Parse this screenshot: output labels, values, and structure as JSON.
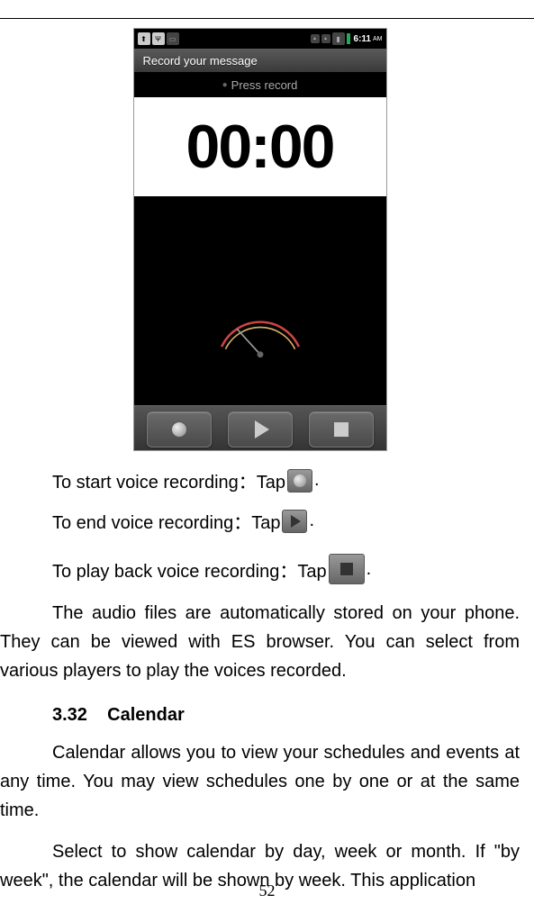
{
  "screenshot": {
    "status_time": "6:11",
    "status_ampm": "AM",
    "title_bar": "Record your message",
    "hint": "Press record",
    "timer": "00:00"
  },
  "instructions": {
    "start_prefix": "To start voice recording：Tap",
    "start_suffix": ".",
    "end_prefix": "To end voice recording：Tap",
    "end_suffix": ".",
    "play_prefix": "To play back voice recording：Tap",
    "play_suffix": "."
  },
  "paragraphs": {
    "audio_files": "The audio files are automatically stored on your phone. They can be viewed with ES browser. You can select from various players to play the voices recorded.",
    "calendar_intro": "Calendar allows you to view your schedules and events at any time. You may view schedules one by one or at the same time.",
    "calendar_select": "Select to show calendar by day, week or month. If \"by week\", the calendar will be shown by week. This application"
  },
  "section": {
    "number": "3.32",
    "title": "Calendar"
  },
  "page_number": "52"
}
